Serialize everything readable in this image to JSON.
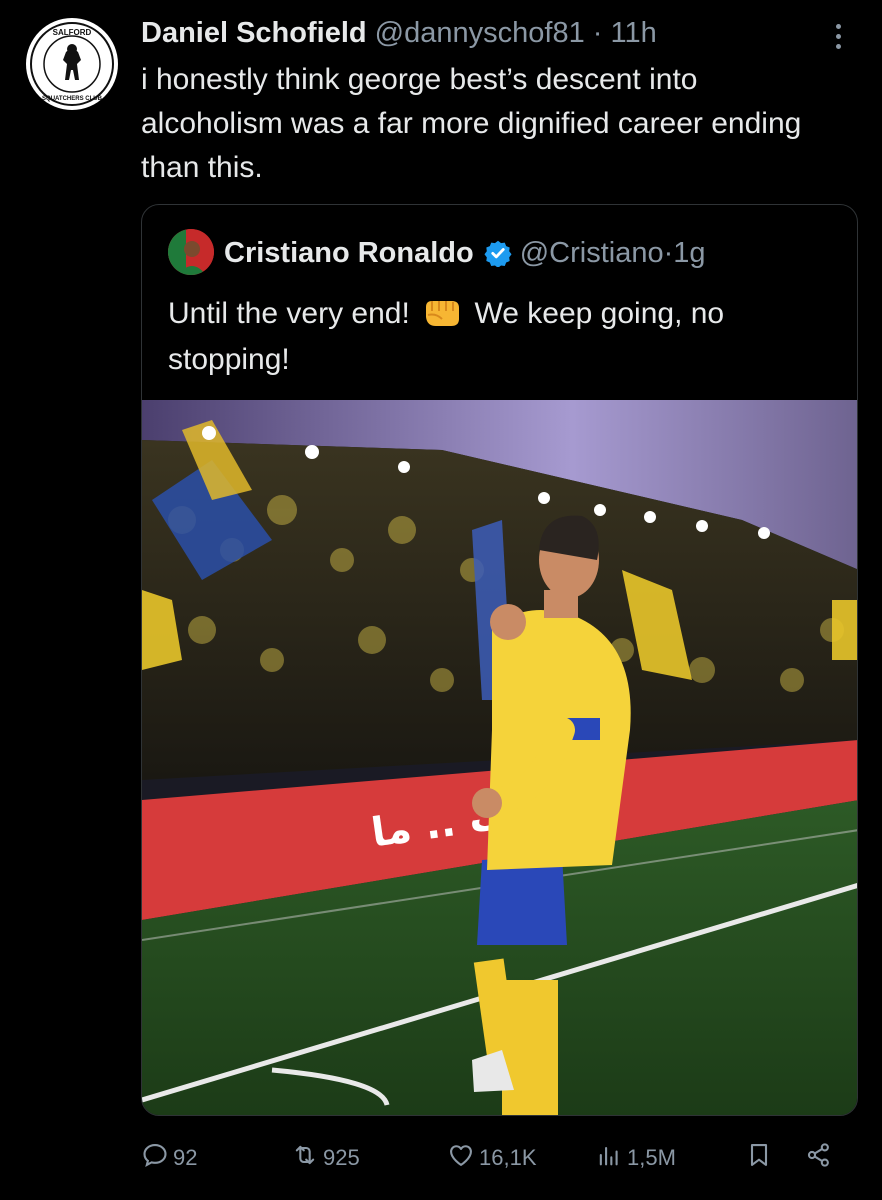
{
  "tweet": {
    "author_name": "Daniel Schofield",
    "handle": "@dannyschof81",
    "separator": "·",
    "time": "11h",
    "text": "i honestly think george best’s descent into alcoholism was a far more dignified career ending than this.",
    "avatar_text_top": "SALFORD",
    "avatar_text_bottom": "SQUATCHERS CLUB"
  },
  "quoted": {
    "author_name": "Cristiano Ronaldo",
    "handle": "@Cristiano",
    "separator": "·",
    "time": "1g",
    "text_before_emoji": "Until the very end!",
    "emoji": "oncoming-fist-emoji",
    "text_after_emoji": "We keep going, no stopping!",
    "banner_text": "الشباب .. ما"
  },
  "actions": {
    "replies": "92",
    "retweets": "925",
    "likes": "16,1K",
    "views": "1,5M"
  },
  "icons": [
    "more-icon",
    "verified-icon",
    "reply-icon",
    "retweet-icon",
    "like-icon",
    "views-icon",
    "bookmark-icon",
    "share-icon"
  ],
  "colors": {
    "background": "#000000",
    "text_primary": "#e7e9ea",
    "text_secondary": "#8b98a5",
    "verified": "#1d9bf0",
    "border": "#2f3336"
  }
}
